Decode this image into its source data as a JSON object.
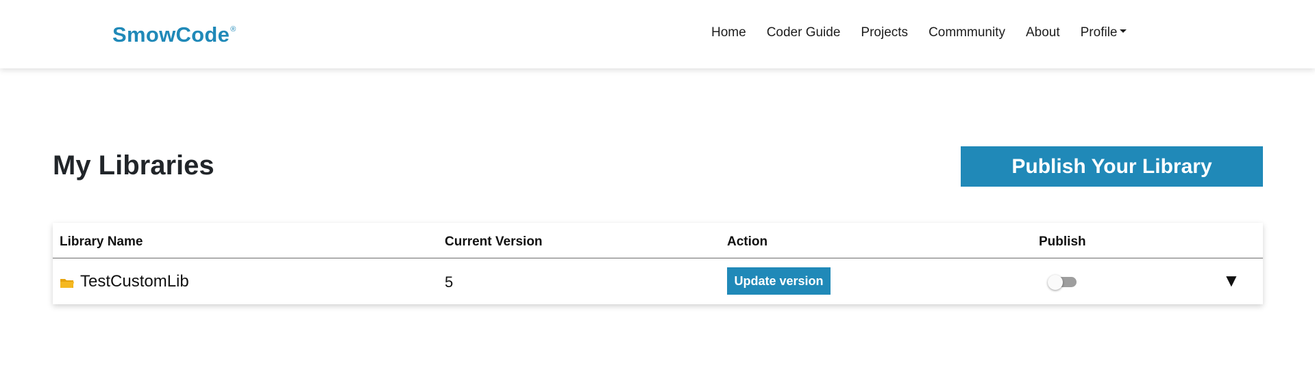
{
  "navbar": {
    "brand": "SmowCode",
    "brand_mark": "®",
    "links": [
      "Home",
      "Coder Guide",
      "Projects",
      "Commmunity",
      "About"
    ],
    "profile_label": "Profile"
  },
  "main": {
    "title": "My Libraries",
    "publish_button": "Publish Your Library"
  },
  "table": {
    "headers": [
      "Library Name",
      "Current Version",
      "Action",
      "Publish"
    ],
    "rows": [
      {
        "name": "TestCustomLib",
        "version": "5",
        "action_label": "Update version",
        "published": false,
        "expand_symbol": "▼"
      }
    ]
  },
  "colors": {
    "accent": "#2089b8",
    "folder": "#f5b820",
    "toggle_off": "#9e9e9e"
  },
  "icons": {
    "row_icon": "folder-icon",
    "profile_dropdown": "caret-down-icon",
    "row_expand": "expand-arrow-icon"
  }
}
